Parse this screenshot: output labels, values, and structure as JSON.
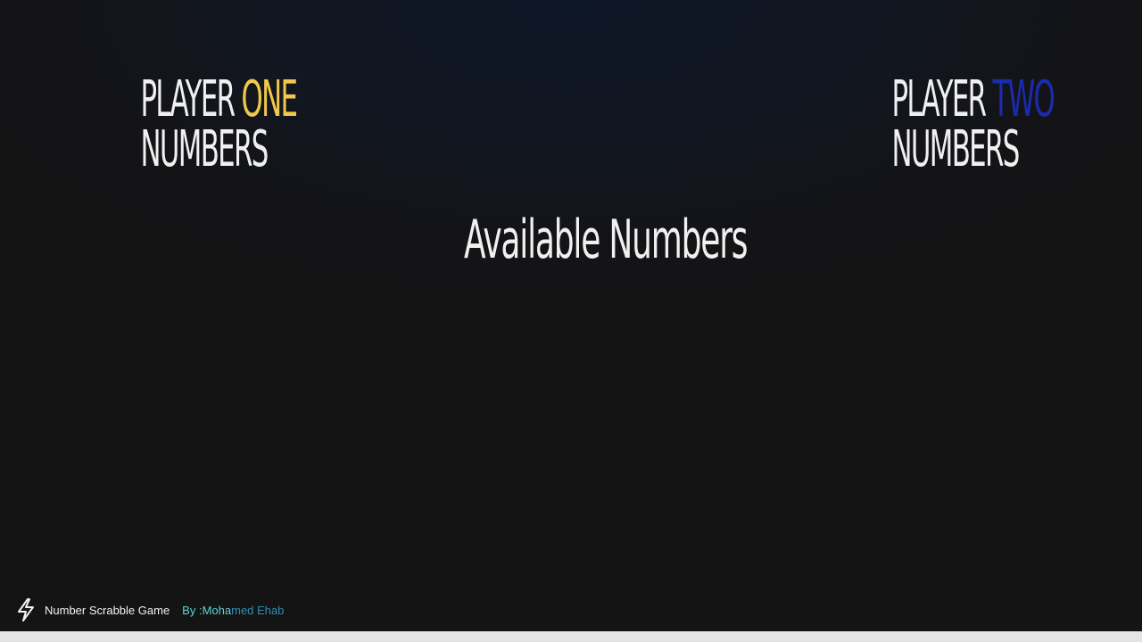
{
  "player_one": {
    "line1_prefix": "PLAYER ",
    "line1_accent": "ONE",
    "line2": "NUMBERS",
    "accent_color": "#f2c84b"
  },
  "player_two": {
    "line1_prefix": "PLAYER ",
    "line1_accent": "TWO",
    "line2": "NUMBERS",
    "accent_color": "#1b2bb0"
  },
  "board": {
    "title": "Available Numbers"
  },
  "footer": {
    "logo_icon": "lightning-bolt-icon",
    "game_name": "Number Scrabble Game",
    "byline_prefix": "By : ",
    "author_part1": "Moha",
    "author_part2": "med Ehab"
  }
}
